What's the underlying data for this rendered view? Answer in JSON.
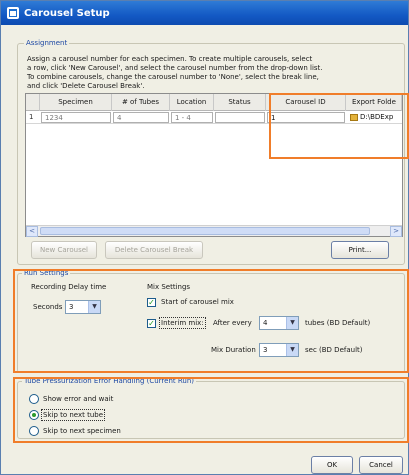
{
  "window": {
    "title": "Carousel Setup"
  },
  "assignment": {
    "title": "Assignment",
    "instructions": [
      "Assign a carousel number for each specimen.  To create multiple carousels, select",
      "a row, click 'New Carousel', and select the carousel number from the drop-down list.",
      "To combine carousels, change the carousel number to 'None', select the break line,",
      "and click 'Delete Carousel Break'."
    ],
    "columns": [
      "",
      "Specimen",
      "# of Tubes",
      "Location",
      "Status",
      "Carousel ID",
      "Export Folde"
    ],
    "rows": [
      {
        "num": "1",
        "specimen": "1234",
        "tubes": "4",
        "location": "1 - 4",
        "status": "",
        "carousel_id": "1",
        "export": "D:\\BDExp"
      }
    ],
    "scroll_left": "<",
    "scroll_right": ">",
    "new_carousel": "New Carousel",
    "delete_break": "Delete Carousel Break",
    "print": "Print..."
  },
  "run_settings": {
    "title": "Run Settings",
    "recording_delay_label": "Recording Delay time",
    "seconds_label": "Seconds",
    "seconds_value": "3",
    "mix_settings_label": "Mix Settings",
    "start_mix_label": "Start of carousel mix",
    "start_mix_checked": true,
    "interim_mix_label": "Interim mix:",
    "interim_mix_checked": true,
    "after_every_label": "After every",
    "after_every_value": "4",
    "tubes_default_label": "tubes (BD Default)",
    "mix_duration_label": "Mix Duration",
    "mix_duration_value": "3",
    "sec_default_label": "sec (BD Default)"
  },
  "pressurization": {
    "title": "Tube Pressurization Error Handling (Current Run)",
    "options": [
      "Show error and wait",
      "Skip to next tube",
      "Skip to next specimen"
    ],
    "selected_index": 1
  },
  "footer": {
    "ok": "OK",
    "cancel": "Cancel"
  },
  "colors": {
    "highlight": "#f07d2a",
    "title_bar": "#1359c4",
    "group_title": "#1d48a3"
  },
  "icons": {
    "app": "window-icon",
    "export": "folder-icon",
    "dropdown": "chevron-down-icon"
  }
}
